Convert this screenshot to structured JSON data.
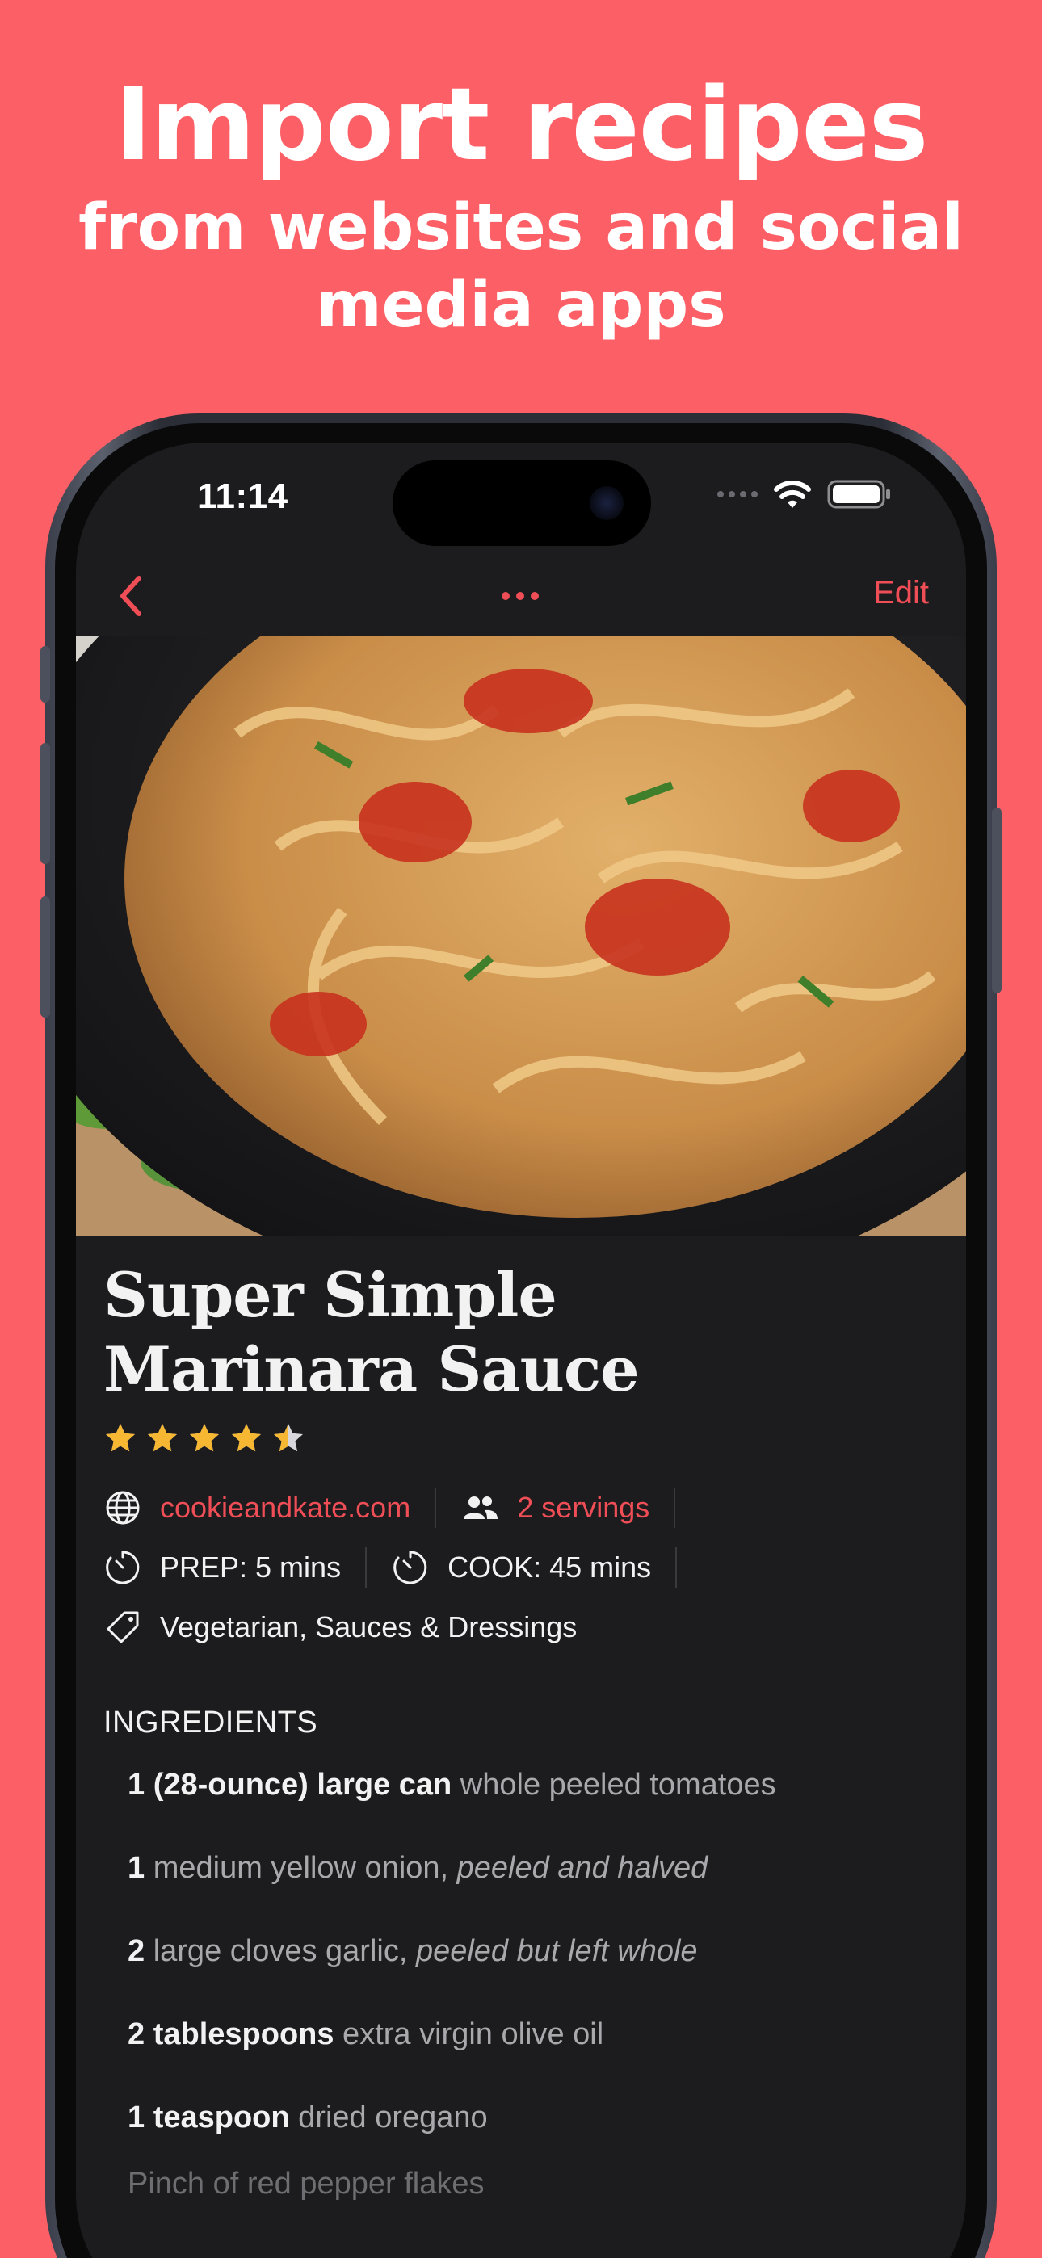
{
  "headline": {
    "title": "Import recipes",
    "subtitle": "from websites and social media apps"
  },
  "status_bar": {
    "time": "11:14"
  },
  "nav": {
    "edit_label": "Edit"
  },
  "recipe": {
    "title_line1": "Super Simple",
    "title_line2": "Marinara Sauce",
    "rating": 4.5,
    "source": "cookieandkate.com",
    "servings": "2 servings",
    "prep": "PREP: 5 mins",
    "cook": "COOK: 45 mins",
    "tags": "Vegetarian, Sauces & Dressings"
  },
  "ingredients_title": "INGREDIENTS",
  "ingredients": [
    {
      "qty": "1 (28-ounce) large can",
      "name": " whole peeled tomatoes",
      "note": ""
    },
    {
      "qty": "1",
      "name": " medium yellow onion, ",
      "note": "peeled and halved"
    },
    {
      "qty": "2",
      "name": " large cloves garlic, ",
      "note": "peeled but left whole"
    },
    {
      "qty": "2 tablespoons",
      "name": " extra virgin olive oil",
      "note": ""
    },
    {
      "qty": "1 teaspoon",
      "name": " dried oregano",
      "note": ""
    }
  ],
  "partial_ingredient": "Pinch of red pepper flakes",
  "colors": {
    "background": "#fd5f66",
    "accent": "#ef4e56",
    "screen": "#1c1c1e",
    "star": "#f6b733"
  },
  "icons": [
    "chevron-left-icon",
    "more-dots-icon",
    "globe-icon",
    "people-icon",
    "timer-icon",
    "tag-icon",
    "star-icon",
    "wifi-icon",
    "battery-icon"
  ]
}
